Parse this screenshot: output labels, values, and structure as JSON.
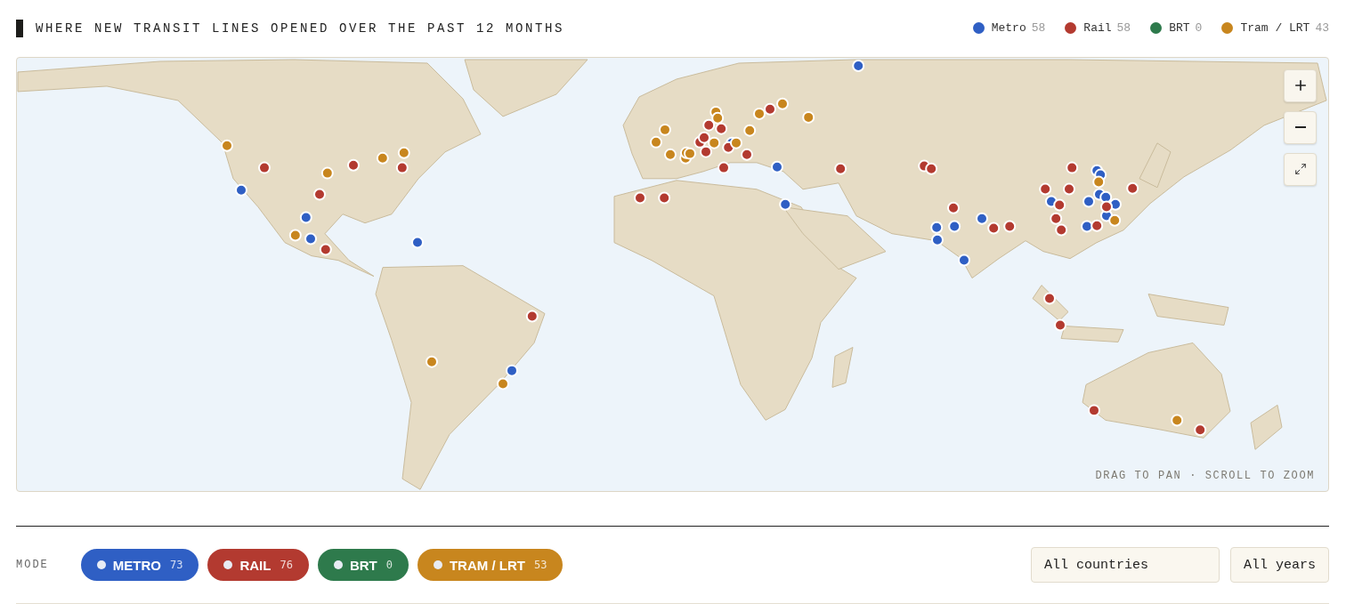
{
  "title": "WHERE NEW TRANSIT LINES OPENED OVER THE PAST 12 MONTHS",
  "legend": [
    {
      "label": "Metro",
      "count": "58",
      "color": "#2f5fc4"
    },
    {
      "label": "Rail",
      "count": "58",
      "color": "#b33a30"
    },
    {
      "label": "BRT",
      "count": "0",
      "color": "#2e7a4c"
    },
    {
      "label": "Tram / LRT",
      "count": "43",
      "color": "#c8861e"
    }
  ],
  "map": {
    "hint": "DRAG TO PAN · SCROLL TO ZOOM"
  },
  "filters": {
    "label": "MODE",
    "chips": [
      {
        "label": "METRO",
        "count": "73",
        "color": "#2f5fc4",
        "selected": true
      },
      {
        "label": "RAIL",
        "count": "76",
        "color": "#b33a30",
        "selected": true
      },
      {
        "label": "BRT",
        "count": "0",
        "color": "#2e7a4c",
        "selected": true
      },
      {
        "label": "TRAM / LRT",
        "count": "53",
        "color": "#c8861e",
        "selected": true
      }
    ],
    "selects": [
      {
        "value": "All countries"
      },
      {
        "value": "All years"
      }
    ]
  }
}
